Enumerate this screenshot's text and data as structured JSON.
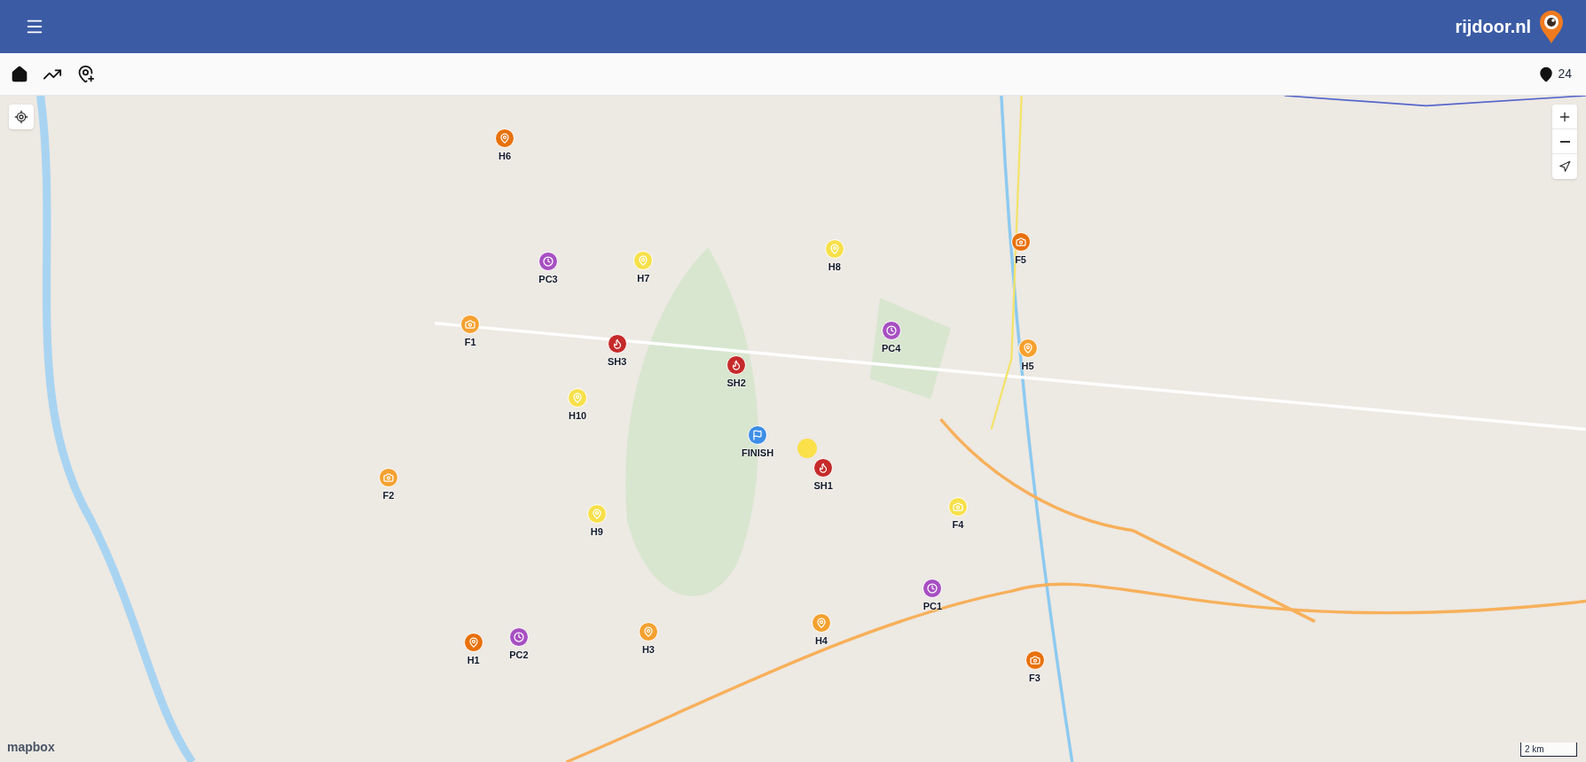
{
  "header": {
    "title": "rijdoor.nl"
  },
  "toolbar": {
    "count": "24"
  },
  "markers": [
    {
      "label": "H6",
      "kind": "pin",
      "color": "#e8710a"
    },
    {
      "label": "PC3",
      "kind": "clock",
      "color": "#a74fc2"
    },
    {
      "label": "H7",
      "kind": "pin",
      "color": "#f7e04a"
    },
    {
      "label": "H8",
      "kind": "pin",
      "color": "#f7e04a"
    },
    {
      "label": "F5",
      "kind": "camera",
      "color": "#e8710a"
    },
    {
      "label": "F1",
      "kind": "camera",
      "color": "#f5a130"
    },
    {
      "label": "SH3",
      "kind": "flame",
      "color": "#c62a2a"
    },
    {
      "label": "SH2",
      "kind": "flame",
      "color": "#c62a2a"
    },
    {
      "label": "PC4",
      "kind": "clock",
      "color": "#a74fc2"
    },
    {
      "label": "H5",
      "kind": "pin",
      "color": "#f5a130"
    },
    {
      "label": "H10",
      "kind": "pin",
      "color": "#f7e04a"
    },
    {
      "label": "FINISH",
      "kind": "flag",
      "color": "#3d8ee6"
    },
    {
      "label": "SH1",
      "kind": "flame",
      "color": "#c62a2a"
    },
    {
      "label": "F2",
      "kind": "camera",
      "color": "#f5a130"
    },
    {
      "label": "F4",
      "kind": "camera",
      "color": "#f7e04a"
    },
    {
      "label": "H9",
      "kind": "pin",
      "color": "#f7e04a"
    },
    {
      "label": "PC1",
      "kind": "clock",
      "color": "#a74fc2"
    },
    {
      "label": "H4",
      "kind": "pin",
      "color": "#f5a130"
    },
    {
      "label": "H3",
      "kind": "pin",
      "color": "#f5a130"
    },
    {
      "label": "PC2",
      "kind": "clock",
      "color": "#a74fc2"
    },
    {
      "label": "H1",
      "kind": "pin",
      "color": "#e8710a"
    },
    {
      "label": "F3",
      "kind": "camera",
      "color": "#e8710a"
    }
  ],
  "map": {
    "attribution": "mapbox",
    "scale": "2 km"
  }
}
